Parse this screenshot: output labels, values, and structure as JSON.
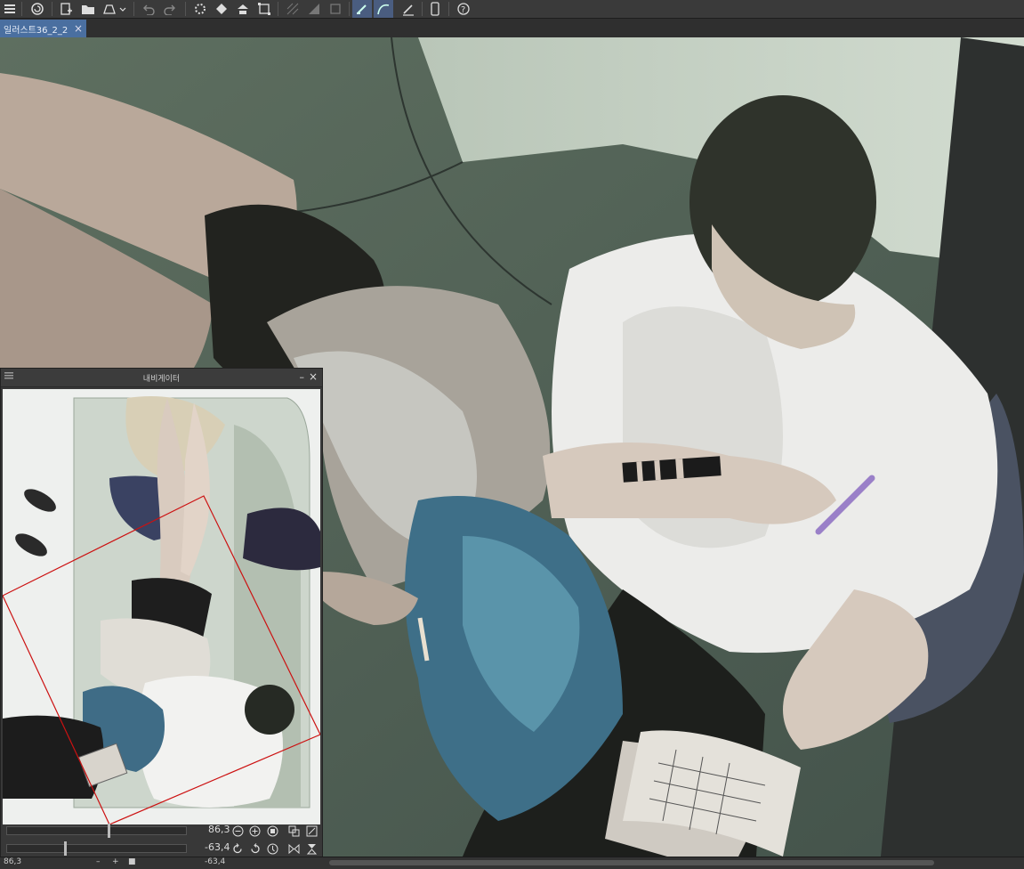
{
  "toolbar": {
    "icons": [
      "menu-icon",
      "spiral-logo-icon",
      "new-file-icon",
      "open-folder-icon",
      "save-icon",
      "undo-icon",
      "redo-icon",
      "loading-spinner-icon",
      "fill-icon",
      "transform-icon",
      "selection-icon",
      "grid-icon",
      "ruler-icon",
      "pen-icon",
      "curve-icon",
      "edit-icon",
      "phone-icon",
      "help-icon"
    ]
  },
  "document_tab": {
    "title": "일러스트36_2_2",
    "close": "×"
  },
  "navigator": {
    "title": "내비게이터",
    "zoom_value": "86,3",
    "rotation_value": "-63,4",
    "menu_icon": "menu-icon",
    "close": "×",
    "minimize": "–"
  },
  "status": {
    "zoom": "86,3",
    "rotation": "-63,4"
  },
  "colors": {
    "toolbar": "#3a3a3a",
    "tab_active": "#4a6fa0",
    "panel": "#383838",
    "nav_frame": "#cc1111"
  }
}
